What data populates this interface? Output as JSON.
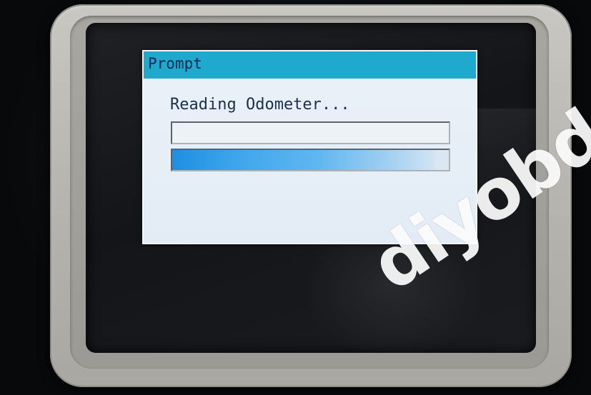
{
  "dialog": {
    "title": "Prompt",
    "status_text": "Reading Odometer...",
    "text_field_value": "",
    "progress": 0.95,
    "titlebar_color": "#1fa9cc",
    "progress_color": "#1e8fe0"
  },
  "watermark": "diyobd"
}
